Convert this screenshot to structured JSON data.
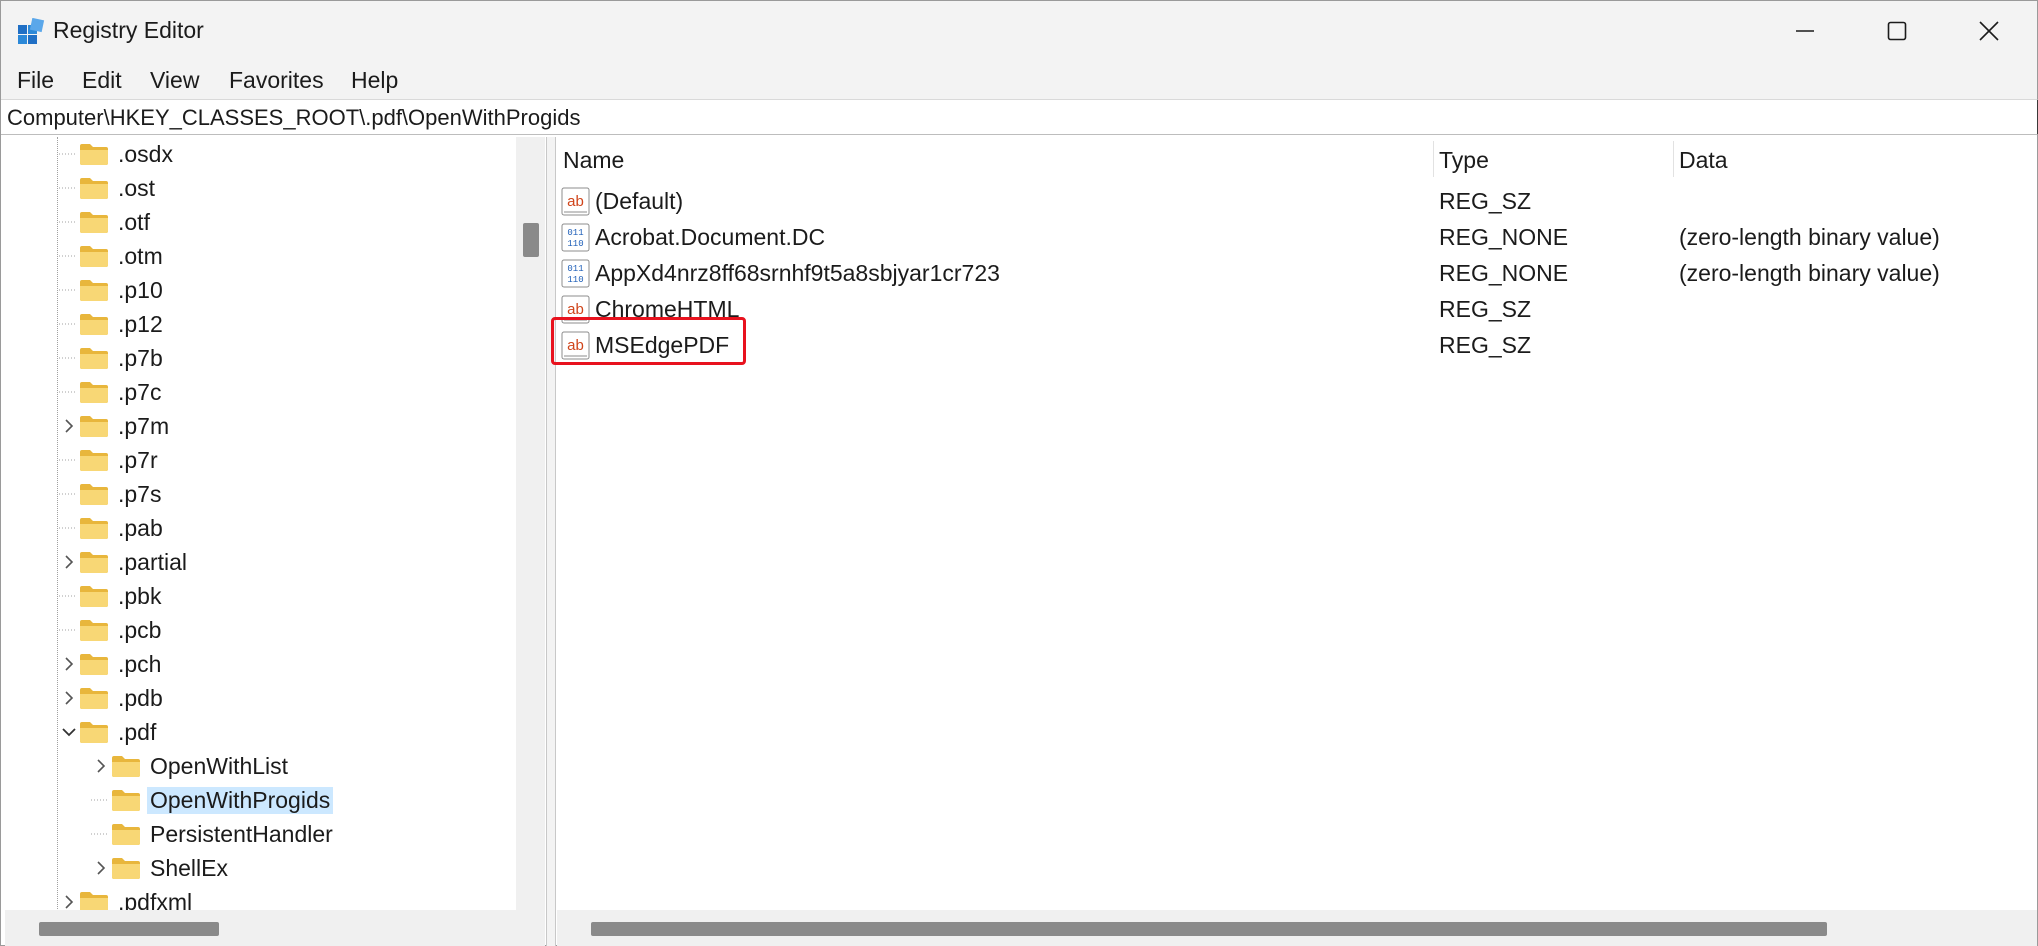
{
  "window": {
    "title": "Registry Editor",
    "controls": {
      "minimize": "minimize-icon",
      "maximize": "maximize-icon",
      "close": "close-icon"
    }
  },
  "menu": [
    "File",
    "Edit",
    "View",
    "Favorites",
    "Help"
  ],
  "address": "Computer\\HKEY_CLASSES_ROOT\\.pdf\\OpenWithProgids",
  "tree": [
    {
      "label": ".osdx",
      "level": 0,
      "expander": "none"
    },
    {
      "label": ".ost",
      "level": 0,
      "expander": "none"
    },
    {
      "label": ".otf",
      "level": 0,
      "expander": "none"
    },
    {
      "label": ".otm",
      "level": 0,
      "expander": "none"
    },
    {
      "label": ".p10",
      "level": 0,
      "expander": "none"
    },
    {
      "label": ".p12",
      "level": 0,
      "expander": "none"
    },
    {
      "label": ".p7b",
      "level": 0,
      "expander": "none"
    },
    {
      "label": ".p7c",
      "level": 0,
      "expander": "none"
    },
    {
      "label": ".p7m",
      "level": 0,
      "expander": "collapsed"
    },
    {
      "label": ".p7r",
      "level": 0,
      "expander": "none"
    },
    {
      "label": ".p7s",
      "level": 0,
      "expander": "none"
    },
    {
      "label": ".pab",
      "level": 0,
      "expander": "none"
    },
    {
      "label": ".partial",
      "level": 0,
      "expander": "collapsed"
    },
    {
      "label": ".pbk",
      "level": 0,
      "expander": "none"
    },
    {
      "label": ".pcb",
      "level": 0,
      "expander": "none"
    },
    {
      "label": ".pch",
      "level": 0,
      "expander": "collapsed"
    },
    {
      "label": ".pdb",
      "level": 0,
      "expander": "collapsed"
    },
    {
      "label": ".pdf",
      "level": 0,
      "expander": "expanded"
    },
    {
      "label": "OpenWithList",
      "level": 1,
      "expander": "collapsed"
    },
    {
      "label": "OpenWithProgids",
      "level": 1,
      "expander": "none",
      "selected": true
    },
    {
      "label": "PersistentHandler",
      "level": 1,
      "expander": "none"
    },
    {
      "label": "ShellEx",
      "level": 1,
      "expander": "collapsed"
    },
    {
      "label": ".pdfxml",
      "level": 0,
      "expander": "collapsed"
    }
  ],
  "list": {
    "columns": [
      "Name",
      "Type",
      "Data"
    ],
    "rows": [
      {
        "icon": "string-value-icon",
        "name": "(Default)",
        "type": "REG_SZ",
        "data": ""
      },
      {
        "icon": "binary-value-icon",
        "name": "Acrobat.Document.DC",
        "type": "REG_NONE",
        "data": "(zero-length binary value)"
      },
      {
        "icon": "binary-value-icon",
        "name": "AppXd4nrz8ff68srnhf9t5a8sbjyar1cr723",
        "type": "REG_NONE",
        "data": "(zero-length binary value)"
      },
      {
        "icon": "string-value-icon",
        "name": "ChromeHTML",
        "type": "REG_SZ",
        "data": ""
      },
      {
        "icon": "string-value-icon",
        "name": "MSEdgePDF",
        "type": "REG_SZ",
        "data": "",
        "highlighted": true
      }
    ]
  },
  "colors": {
    "selection": "#cce8ff",
    "highlight_border": "#e8121e",
    "folder": "#f8d775"
  }
}
